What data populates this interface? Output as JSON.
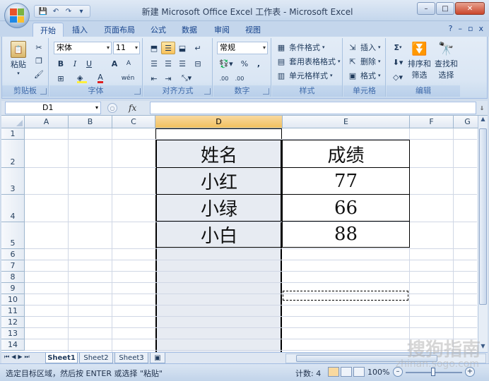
{
  "window": {
    "title": "新建 Microsoft Office Excel 工作表 - Microsoft Excel",
    "controls": [
      "–",
      "□",
      "✕"
    ]
  },
  "ribbon_tabs": [
    {
      "label": "开始",
      "active": true
    },
    {
      "label": "插入"
    },
    {
      "label": "页面布局"
    },
    {
      "label": "公式"
    },
    {
      "label": "数据"
    },
    {
      "label": "审阅"
    },
    {
      "label": "视图"
    }
  ],
  "ribbon_right": {
    "help": "?",
    "minimize": "–",
    "restore": "▫",
    "close": "x"
  },
  "clipboard": {
    "label": "剪贴板",
    "paste": "粘贴"
  },
  "font": {
    "label": "字体",
    "name": "宋体",
    "size": "11",
    "bold": "B",
    "italic": "I",
    "underline": "U",
    "grow": "A",
    "shrink": "A",
    "phonetic": "wén",
    "font_color": "A",
    "accent_color": "#e02020",
    "fill_color": "#ffef3c"
  },
  "alignment": {
    "label": "对齐方式"
  },
  "number": {
    "label": "数字",
    "format": "常规",
    "percent": "%",
    "comma": ",",
    "inc_decimal": ".00",
    "dec_decimal": ".00"
  },
  "styles": {
    "label": "样式",
    "conditional": "条件格式",
    "table_format": "套用表格格式",
    "cell_style": "单元格样式"
  },
  "cells": {
    "label": "单元格",
    "insert": "插入",
    "delete": "删除",
    "format": "格式"
  },
  "editing": {
    "label": "编辑",
    "sum": "Σ",
    "sort_filter_1": "排序和",
    "sort_filter_2": "筛选",
    "find_select_1": "查找和",
    "find_select_2": "选择"
  },
  "formula_bar": {
    "name_box": "D1",
    "fx": "fx",
    "value": ""
  },
  "columns": [
    "A",
    "B",
    "C",
    "D",
    "E",
    "F",
    "G"
  ],
  "rows": [
    "1",
    "2",
    "3",
    "4",
    "5",
    "6",
    "7",
    "8",
    "9",
    "10",
    "11",
    "12",
    "13",
    "14"
  ],
  "table": {
    "header": [
      "姓名",
      "成绩"
    ],
    "rows": [
      [
        "小红",
        "77"
      ],
      [
        "小绿",
        "66"
      ],
      [
        "小白",
        "88"
      ]
    ]
  },
  "sheets": [
    {
      "label": "Sheet1",
      "active": true
    },
    {
      "label": "Sheet2"
    },
    {
      "label": "Sheet3"
    }
  ],
  "status": {
    "message": "选定目标区域，然后按 ENTER 或选择 \"粘贴\"",
    "count": "计数: 4",
    "zoom": "100%",
    "zoom_minus": "–",
    "zoom_plus": "+"
  },
  "watermark": {
    "text": "搜狗指南",
    "url": "zhinan.sogo.com"
  }
}
